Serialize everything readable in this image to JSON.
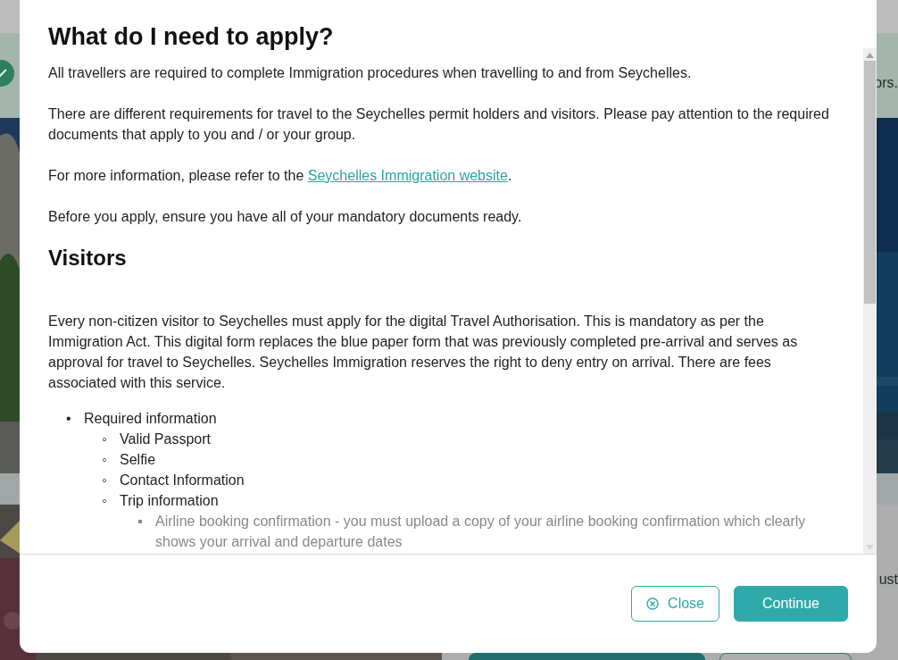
{
  "backdrop": {
    "fragments": [
      {
        "text": "ors."
      },
      {
        "text": "ust"
      }
    ]
  },
  "modal": {
    "title": "What do I need to apply?",
    "intro": [
      {
        "text": "All travellers are required to complete Immigration procedures when travelling to and from Seychelles."
      },
      {
        "text": "There are different requirements for travel to the Seychelles permit holders and visitors. Please pay attention to the required documents that apply to you and / or your group."
      },
      {
        "text": "For more information, please refer to the ",
        "link": "Seychelles Immigration website",
        "after": "."
      },
      {
        "text": "Before you apply, ensure you have all of your mandatory documents ready."
      }
    ],
    "section": {
      "heading": "Visitors",
      "paragraph": "Every non-citizen visitor to Seychelles must apply for the digital Travel Authorisation. This is mandatory as per the Immigration Act. This digital form replaces the blue paper form that was previously completed pre-arrival and serves as approval for travel to Seychelles. Seychelles Immigration reserves the right to deny entry on arrival. There are fees associated with this service.",
      "list": [
        {
          "marker": "•",
          "text": "Required information",
          "children": [
            {
              "marker": "◦",
              "text": "Valid Passport"
            },
            {
              "marker": "◦",
              "text": "Selfie"
            },
            {
              "marker": "◦",
              "text": "Contact Information"
            },
            {
              "marker": "◦",
              "text": "Trip information",
              "children": [
                {
                  "marker": "▪",
                  "text": "Airline booking confirmation - you must upload a copy of your airline booking confirmation which clearly shows your arrival and departure dates"
                }
              ]
            }
          ]
        }
      ]
    },
    "buttons": [
      {
        "label": "Close",
        "kind": "secondary"
      },
      {
        "label": "Continue",
        "kind": "primary"
      }
    ]
  }
}
